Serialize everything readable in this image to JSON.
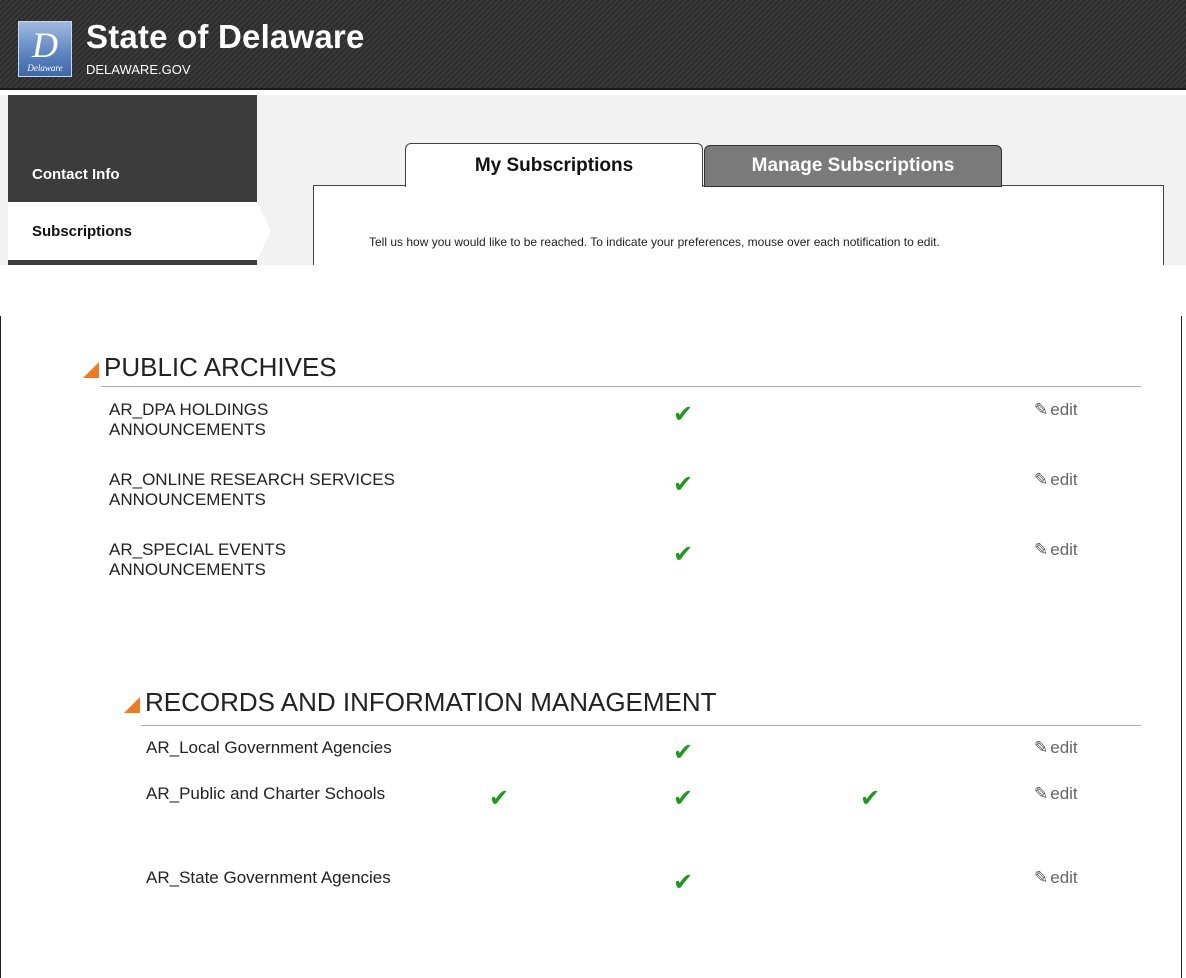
{
  "header": {
    "logo_letter": "D",
    "logo_word": "Delaware",
    "title": "State of Delaware",
    "subtitle": "DELAWARE.GOV"
  },
  "sidebar": {
    "items": [
      {
        "label": "Contact Info",
        "active": false
      },
      {
        "label": "Subscriptions",
        "active": true
      }
    ]
  },
  "tabs": [
    {
      "label": "My Subscriptions",
      "active": true
    },
    {
      "label": "Manage Subscriptions",
      "active": false
    }
  ],
  "instruction": "Tell us how you would like to be reached. To indicate your preferences, mouse over each notification to edit.",
  "icons": {
    "check": "✔",
    "pencil": "✎",
    "section_triangle": "triangle-icon"
  },
  "colors": {
    "check": "#1c9a1c",
    "triangle": "#f07a22"
  },
  "sections": [
    {
      "title": "PUBLIC ARCHIVES",
      "rows": [
        {
          "name": "AR_DPA HOLDINGS ANNOUNCEMENTS",
          "channels": [
            false,
            true,
            false
          ],
          "edit": "edit"
        },
        {
          "name": "AR_ONLINE RESEARCH SERVICES ANNOUNCEMENTS",
          "channels": [
            false,
            true,
            false
          ],
          "edit": "edit"
        },
        {
          "name": "AR_SPECIAL EVENTS ANNOUNCEMENTS",
          "channels": [
            false,
            true,
            false
          ],
          "edit": "edit"
        }
      ]
    },
    {
      "title": "RECORDS AND INFORMATION MANAGEMENT",
      "rows": [
        {
          "name": "AR_Local Government Agencies",
          "channels": [
            false,
            true,
            false
          ],
          "edit": "edit"
        },
        {
          "name": "AR_Public and Charter Schools",
          "channels": [
            true,
            true,
            true
          ],
          "edit": "edit"
        },
        {
          "name": "AR_State Government Agencies",
          "channels": [
            false,
            true,
            false
          ],
          "edit": "edit"
        }
      ]
    }
  ]
}
